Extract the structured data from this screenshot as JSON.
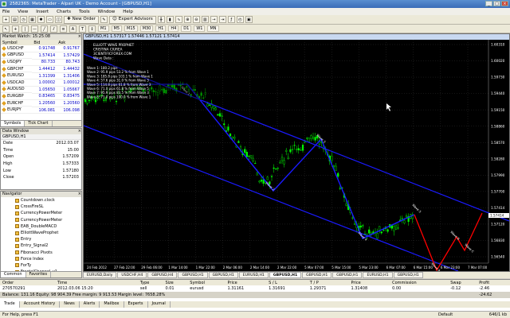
{
  "window": {
    "title": "2582365: MetaTrader - Alpari UK - Demo Account - [GBPUSD,H1]"
  },
  "menu": [
    "File",
    "View",
    "Insert",
    "Charts",
    "Tools",
    "Window",
    "Help"
  ],
  "toolbar": {
    "new_order": "New Order",
    "expert_advisors": "Expert Advisors"
  },
  "toolbar2": [
    "M1",
    "M5",
    "M15",
    "M30",
    "H1",
    "H4",
    "D1",
    "W1",
    "MN"
  ],
  "market_watch": {
    "title": "Market Watch: 15:25:08",
    "headers": [
      "Symbol",
      "Bid",
      "Ask"
    ],
    "rows": [
      [
        "USDCHF",
        "0.91748",
        "0.91767"
      ],
      [
        "GBPUSD",
        "1.57414",
        "1.57429"
      ],
      [
        "USDJPY",
        "80.733",
        "80.743"
      ],
      [
        "GBPCHF",
        "1.44412",
        "1.44432"
      ],
      [
        "EURUSD",
        "1.31399",
        "1.31406"
      ],
      [
        "USDCAD",
        "1.00002",
        "1.00012"
      ],
      [
        "AUDUSD",
        "1.05650",
        "1.05667"
      ],
      [
        "EURGBP",
        "0.83465",
        "0.83475"
      ],
      [
        "EURCHF",
        "1.20560",
        "1.20560"
      ],
      [
        "EURJPY",
        "106.081",
        "106.098"
      ]
    ],
    "tabs": [
      "Symbols",
      "Tick Chart"
    ]
  },
  "data_window": {
    "title": "Data Window",
    "symbol": "GBPUSD,H1",
    "rows": [
      [
        "Date",
        "2012.03.07"
      ],
      [
        "Time",
        "15:00"
      ],
      [
        "Open",
        "1.57209"
      ],
      [
        "High",
        "1.57333"
      ],
      [
        "Low",
        "1.57180"
      ],
      [
        "Close",
        "1.57203"
      ]
    ]
  },
  "navigator": {
    "title": "Navigator",
    "items": [
      "Countdown.clock",
      "CrossFireSL",
      "CurrencyPowerMeter",
      "CurrencyPowerMeter",
      "EAB_DoubleMACD",
      "ElliottWaveProphet",
      "Entry",
      "Entry_Signal2",
      "Fibonacci Pivots",
      "Force Index",
      "ForTy",
      "FractalChannel_v1"
    ],
    "tabs": [
      "Common",
      "Favorites"
    ]
  },
  "chart": {
    "title": "GBPUSD,H1 1.57317 1.57446 1.57121 1.57414",
    "overlay": [
      "ELLIOTT WAVE PROPHET",
      "CRISTINA CIUREA",
      "3CIENTIFICFOREX.COM",
      "Wave Data :"
    ],
    "wave_lines": [
      "Wave 1: 180.2 pips",
      "Wave 2: 95.9 pips 53.2 % from Wave 1",
      "Wave 3: 185.8 pips 103.1 % from Wave 1",
      "Wave 4: 57.6 pips 31.0 % from Wave 3",
      "Wave 5: 114.8 pips 61.8 % from Wave 3",
      "Wave 6: 71.0 pips 61.8 % from Wave 5",
      "Wave 7: 95.9 pips 83.5 % from Wave 3",
      "Wave 8: 71.0 pips 100.0 % from Wave 1"
    ],
    "price_ticks": [
      "1.60310",
      "1.60020",
      "1.59730",
      "1.59440",
      "1.59150",
      "1.58860",
      "1.58570",
      "1.58280",
      "1.57990",
      "1.57700",
      "1.57414",
      "1.57120",
      "1.56830",
      "1.56540"
    ],
    "time_ticks": [
      "24 Feb 2012",
      "27 Feb 22:00",
      "29 Feb 06:00",
      "1 Mar 14:00",
      "1 Mar 22:00",
      "2 Mar 06:00",
      "2 Mar 14:00",
      "2 Mar 22:00",
      "5 Mar 07:00",
      "5 Mar 15:00",
      "5 Mar 23:00",
      "6 Mar 07:00",
      "6 Mar 15:00",
      "6 Mar 23:00",
      "7 Mar 07:00"
    ],
    "wave_tags": [
      "Wave 1",
      "Wave 2",
      "Wave 3",
      "Wave 4",
      "Wave 5",
      "Wave A",
      "Wave B",
      "Wave C"
    ],
    "price_label": "1.57414",
    "colors": {
      "channel": "#1a1aff",
      "bull": "#00ff00",
      "bear": "#00ff00",
      "projection": "#ff0000",
      "bg": "#000000",
      "grid": "#3a3a3a"
    }
  },
  "chart_tabs": [
    "EURUSD,Daily",
    "USDCHF,H4",
    "GBPUSD,H4",
    "GBPUSD,H1",
    "GBPUSD,H1",
    "EURUSD,H1",
    "GBPUSD,H1",
    "GBPUSD,H1",
    "GBPUSD,H1",
    "EURUSD,H1",
    "GBPUSD,H1"
  ],
  "terminal": {
    "headers": [
      "Order",
      "Time",
      "Type",
      "Size",
      "Symbol",
      "Price",
      "S / L",
      "T / P",
      "Price",
      "Commission",
      "Swap",
      "Profit"
    ],
    "row": [
      "270570291",
      "2012.03.06 15:20",
      "sell",
      "0.01",
      "eurusd",
      "1.31161",
      "1.31691",
      "1.29371",
      "1.31408",
      "0.00",
      "-0.12",
      "-2.46"
    ],
    "balance_line": "Balance: 131.16 Equity: 98 904.39 Free margin: 9 913.53 Margin level: 7658.28%",
    "balance_profit": "-24.62",
    "tabs": [
      "Trade",
      "Account History",
      "News",
      "Alerts",
      "Mailbox",
      "Experts",
      "Journal"
    ]
  },
  "status": {
    "help": "For Help, press F1",
    "profile": "Default",
    "traffic": "646/1 kb"
  }
}
